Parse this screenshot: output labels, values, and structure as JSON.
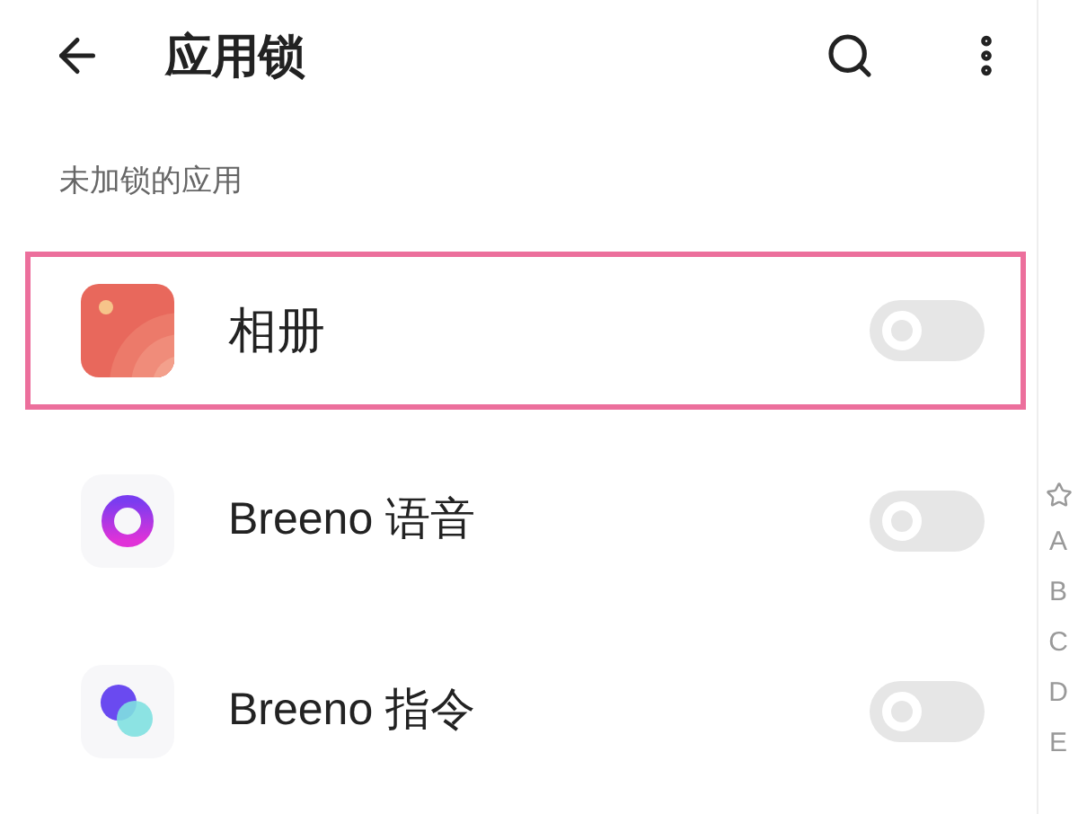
{
  "header": {
    "title": "应用锁"
  },
  "section": {
    "label": "未加锁的应用"
  },
  "apps": [
    {
      "name": "相册",
      "kind": "gallery",
      "on": false,
      "highlighted": true
    },
    {
      "name": "Breeno 语音",
      "kind": "voice",
      "on": false,
      "highlighted": false
    },
    {
      "name": "Breeno 指令",
      "kind": "command",
      "on": false,
      "highlighted": false
    }
  ],
  "index": [
    "A",
    "B",
    "C",
    "D",
    "E"
  ]
}
